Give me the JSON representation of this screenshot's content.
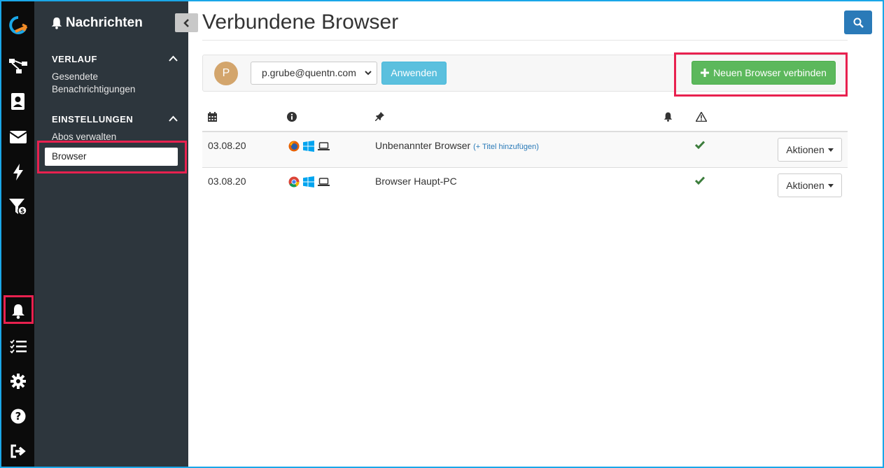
{
  "sidebar": {
    "title": "Nachrichten",
    "sections": [
      {
        "label": "VERLAUF",
        "links": [
          "Gesendete",
          "Benachrichtigungen"
        ]
      },
      {
        "label": "EINSTELLUNGEN",
        "links": [
          "Abos verwalten"
        ],
        "active": "Browser"
      }
    ]
  },
  "header": {
    "title": "Verbundene Browser"
  },
  "toolbar": {
    "avatar_letter": "P",
    "user_select": "p.grube@quentn.com",
    "apply_label": "Anwenden",
    "connect_label": "Neuen Browser verbinden"
  },
  "table": {
    "columns": [
      "calendar-icon",
      "info-icon",
      "pin-icon",
      "bell-icon",
      "warning-icon"
    ],
    "rows": [
      {
        "date": "03.08.20",
        "browser": "firefox",
        "os": "windows",
        "device": "laptop",
        "name": "Unbenannter Browser",
        "add_title": "(+ Titel hinzufügen)",
        "active": true,
        "actions": "Aktionen"
      },
      {
        "date": "03.08.20",
        "browser": "chrome",
        "os": "windows",
        "device": "laptop",
        "name": "Browser Haupt-PC",
        "add_title": "",
        "active": true,
        "actions": "Aktionen"
      }
    ]
  },
  "colors": {
    "accent": "#1aa7e8",
    "success": "#5cb85c",
    "info": "#5bc0de",
    "primary": "#2a7ab8",
    "highlight": "#e8214f",
    "check": "#3c7d3c"
  }
}
